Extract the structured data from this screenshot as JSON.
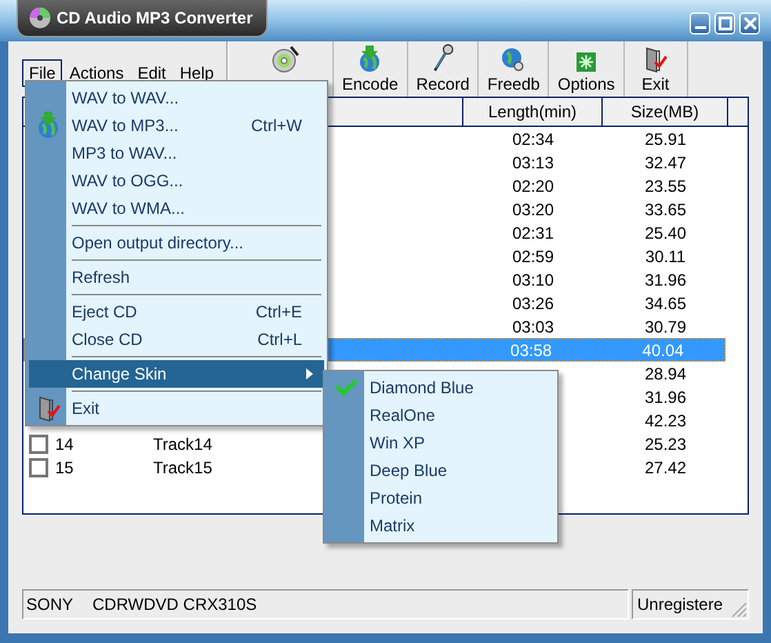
{
  "window": {
    "title": "CD Audio MP3 Converter"
  },
  "menu_bar": [
    {
      "label": "File",
      "selected": true
    },
    {
      "label": "Actions",
      "selected": false
    },
    {
      "label": "Edit",
      "selected": false
    },
    {
      "label": "Help",
      "selected": false
    }
  ],
  "toolbar": [
    {
      "kind": "extract"
    },
    {
      "kind": "encode",
      "label": "Encode"
    },
    {
      "kind": "record",
      "label": "Record"
    },
    {
      "kind": "freedb",
      "label": "Freedb"
    },
    {
      "kind": "options",
      "label": "Options"
    },
    {
      "kind": "exit",
      "label": "Exit"
    }
  ],
  "table": {
    "columns": [
      "Length(min)",
      "Size(MB)"
    ],
    "rows": [
      {
        "length": "02:34",
        "size": "25.91",
        "selected": false
      },
      {
        "length": "03:13",
        "size": "32.47",
        "selected": false
      },
      {
        "length": "02:20",
        "size": "23.55",
        "selected": false
      },
      {
        "length": "03:20",
        "size": "33.65",
        "selected": false
      },
      {
        "length": "02:31",
        "size": "25.40",
        "selected": false
      },
      {
        "length": "02:59",
        "size": "30.11",
        "selected": false
      },
      {
        "length": "03:10",
        "size": "31.96",
        "selected": false
      },
      {
        "length": "03:26",
        "size": "34.65",
        "selected": false
      },
      {
        "length": "03:03",
        "size": "30.79",
        "selected": false
      },
      {
        "length": "03:58",
        "size": "40.04",
        "selected": true
      },
      {
        "size": "28.94",
        "selected": false
      },
      {
        "size": "31.96",
        "selected": false
      },
      {
        "size": "42.23",
        "selected": false
      },
      {
        "number": "14",
        "name": "Track14",
        "checked": false,
        "size": "25.23",
        "selected": false
      },
      {
        "number": "15",
        "name": "Track15",
        "checked": false,
        "size": "27.42",
        "selected": false
      }
    ]
  },
  "file_menu": [
    {
      "kind": "plain",
      "label": "WAV to WAV...",
      "selected": false
    },
    {
      "kind": "encode",
      "label": "WAV to MP3...",
      "shortcut": "Ctrl+W",
      "selected": false
    },
    {
      "kind": "plain",
      "label": "MP3 to WAV...",
      "selected": false
    },
    {
      "kind": "plain",
      "label": "WAV to OGG...",
      "selected": false
    },
    {
      "kind": "plain",
      "label": "WAV to WMA...",
      "selected": false
    },
    {
      "kind": "separator"
    },
    {
      "kind": "plain",
      "label": "Open output directory...",
      "selected": false
    },
    {
      "kind": "separator"
    },
    {
      "kind": "plain",
      "label": "Refresh",
      "selected": false
    },
    {
      "kind": "separator"
    },
    {
      "kind": "plain",
      "label": "Eject CD",
      "shortcut": "Ctrl+E",
      "selected": false
    },
    {
      "kind": "plain",
      "label": "Close CD",
      "shortcut": "Ctrl+L",
      "selected": false
    },
    {
      "kind": "separator"
    },
    {
      "kind": "submenu",
      "label": "Change Skin",
      "selected": true
    },
    {
      "kind": "separator"
    },
    {
      "kind": "exit",
      "label": "Exit",
      "selected": false
    }
  ],
  "skin_menu": [
    {
      "label": "Diamond Blue",
      "checked": true
    },
    {
      "label": "RealOne",
      "checked": false
    },
    {
      "label": "Win XP",
      "checked": false
    },
    {
      "label": "Deep Blue",
      "checked": false
    },
    {
      "label": "Protein",
      "checked": false
    },
    {
      "label": "Matrix",
      "checked": false
    }
  ],
  "status_bar": {
    "vendor": "SONY",
    "drive": "CDRWDVD CRX310S",
    "registration": "Unregistere"
  }
}
